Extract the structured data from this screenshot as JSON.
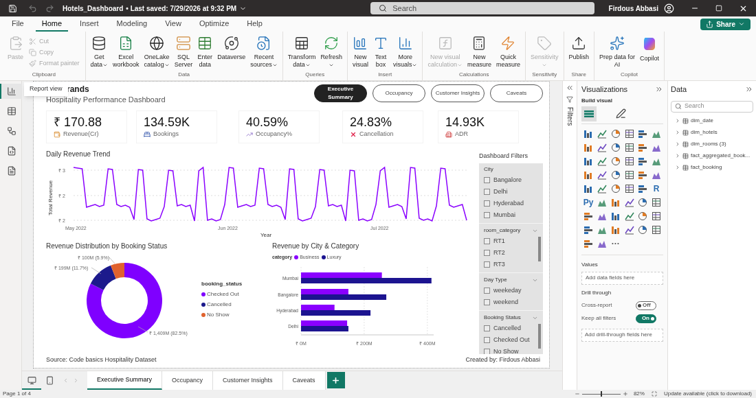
{
  "title_bar": {
    "file_name": "Hotels_Dashboard",
    "saved": "• Last saved: 7/29/2026 at 9:32 PM",
    "search": {
      "placeholder": "Search"
    },
    "user": "Firdous Abbasi"
  },
  "menu_tabs": [
    {
      "label": "File",
      "selected": false
    },
    {
      "label": "Home",
      "selected": true
    },
    {
      "label": "Insert",
      "selected": false
    },
    {
      "label": "Modeling",
      "selected": false
    },
    {
      "label": "View",
      "selected": false
    },
    {
      "label": "Optimize",
      "selected": false
    },
    {
      "label": "Help",
      "selected": false
    }
  ],
  "share_button": {
    "label": "Share"
  },
  "ribbon": [
    {
      "group": "Clipboard",
      "items": [
        {
          "kind": "large",
          "lines": [
            "Paste"
          ],
          "dropdown": false,
          "disabled": true
        },
        {
          "kind": "small",
          "lines": [
            "Cut"
          ],
          "dropdown": false,
          "disabled": true
        },
        {
          "kind": "small",
          "lines": [
            "Copy"
          ],
          "dropdown": false,
          "disabled": true
        },
        {
          "kind": "small",
          "lines": [
            "Format painter"
          ],
          "dropdown": false,
          "disabled": true
        }
      ]
    },
    {
      "group": "Data",
      "items": [
        {
          "kind": "large",
          "lines": [
            "Get",
            "data"
          ],
          "dropdown": true,
          "disabled": false
        },
        {
          "kind": "large",
          "lines": [
            "Excel",
            "workbook"
          ],
          "dropdown": false,
          "disabled": false
        },
        {
          "kind": "large",
          "lines": [
            "OneLake",
            "catalog"
          ],
          "dropdown": true,
          "disabled": false
        },
        {
          "kind": "large",
          "lines": [
            "SQL",
            "Server"
          ],
          "dropdown": false,
          "disabled": false
        },
        {
          "kind": "large",
          "lines": [
            "Enter",
            "data"
          ],
          "dropdown": false,
          "disabled": false
        },
        {
          "kind": "large",
          "lines": [
            "Dataverse"
          ],
          "dropdown": false,
          "disabled": false
        },
        {
          "kind": "large",
          "lines": [
            "Recent",
            "sources"
          ],
          "dropdown": true,
          "disabled": false
        }
      ]
    },
    {
      "group": "Queries",
      "items": [
        {
          "kind": "large",
          "lines": [
            "Transform",
            "data"
          ],
          "dropdown": true,
          "disabled": false
        },
        {
          "kind": "large",
          "lines": [
            "Refresh"
          ],
          "dropdown": true,
          "disabled": false
        }
      ]
    },
    {
      "group": "Insert",
      "items": [
        {
          "kind": "large",
          "lines": [
            "New",
            "visual"
          ],
          "dropdown": false,
          "disabled": false
        },
        {
          "kind": "large",
          "lines": [
            "Text",
            "box"
          ],
          "dropdown": false,
          "disabled": false
        },
        {
          "kind": "large",
          "lines": [
            "More",
            "visuals"
          ],
          "dropdown": true,
          "disabled": false
        }
      ]
    },
    {
      "group": "Calculations",
      "items": [
        {
          "kind": "large",
          "lines": [
            "New visual",
            "calculation"
          ],
          "dropdown": true,
          "disabled": true
        },
        {
          "kind": "large",
          "lines": [
            "New",
            "measure"
          ],
          "dropdown": false,
          "disabled": false
        },
        {
          "kind": "large",
          "lines": [
            "Quick",
            "measure"
          ],
          "dropdown": false,
          "disabled": false
        }
      ]
    },
    {
      "group": "Sensitivity",
      "items": [
        {
          "kind": "large",
          "lines": [
            "Sensitivity"
          ],
          "dropdown": true,
          "disabled": true
        }
      ]
    },
    {
      "group": "Share",
      "items": [
        {
          "kind": "large",
          "lines": [
            "Publish"
          ],
          "dropdown": false,
          "disabled": false
        }
      ]
    },
    {
      "group": "Copilot",
      "items": [
        {
          "kind": "large",
          "lines": [
            "Prep data for",
            "AI"
          ],
          "dropdown": false,
          "disabled": false
        },
        {
          "kind": "large",
          "lines": [
            "Copilot"
          ],
          "dropdown": false,
          "disabled": false
        }
      ]
    }
  ],
  "views": [
    {
      "selected": true
    },
    {
      "selected": false
    },
    {
      "selected": false
    },
    {
      "selected": false
    },
    {
      "selected": false
    }
  ],
  "tooltip": "Report view",
  "report": {
    "title": "rands",
    "subtitle": "Hospitality Performance Dashboard",
    "nav_buttons": [
      {
        "label": "Executive Summary",
        "selected": true
      },
      {
        "label": "Occupancy",
        "selected": false
      },
      {
        "label": "Customer Insights",
        "selected": false
      },
      {
        "label": "Caveats",
        "selected": false
      }
    ],
    "kpis": [
      {
        "value": "₹ 170.88",
        "label": "Revenue(Cr)"
      },
      {
        "value": "134.59K",
        "label": "Bookings"
      },
      {
        "value": "40.59%",
        "label": "Occupancy%"
      },
      {
        "value": "24.83%",
        "label": "Cancellation"
      },
      {
        "value": "14.93K",
        "label": "ADR"
      }
    ],
    "trend_chart": {
      "title": "Daily Revenue Trend",
      "ylabel": "Total Revenue",
      "xlabel": "Year",
      "ytick_labels": [
        "₹ 3",
        "₹ 2",
        "₹ 2"
      ],
      "xtick_labels": [
        "May 2022",
        "Jun 2022",
        "Jul 2022"
      ]
    },
    "donut": {
      "title": "Revenue Distribution by Booking Status",
      "chart_data": {
        "type": "donut",
        "categories": [
          "Checked Out",
          "Cancelled",
          "No Show"
        ],
        "values": [
          82.5,
          11.7,
          5.9
        ],
        "value_labels": [
          "₹ 1,409M (82.5%)",
          "₹ 199M (11.7%)",
          "₹ 100M (5.9%)"
        ]
      },
      "legend": {
        "title": "booking_status",
        "items": [
          {
            "color": "#7f00ff"
          },
          {
            "color": "#1c1a8c"
          },
          {
            "color": "#e0622e"
          }
        ]
      }
    },
    "bar_chart": {
      "title": "Revenue by City & Category",
      "legend_title": "category",
      "chart_data": {
        "type": "bar",
        "orientation": "horizontal",
        "categories": [
          "Mumbai",
          "Bangalore",
          "Hyderabad",
          "Delhi"
        ],
        "series": [
          {
            "name": "Business",
            "color": "#8a00ff",
            "values": [
              256,
              150,
              106,
              146
            ]
          },
          {
            "name": "Luxury",
            "color": "#1c1490",
            "values": [
              413,
              270,
              220,
              150
            ]
          }
        ],
        "xlim": [
          0,
          420
        ],
        "xticks": [
          {
            "value": 0,
            "label": "₹ 0M"
          },
          {
            "value": 200,
            "label": "₹ 200M"
          },
          {
            "value": 400,
            "label": "₹ 400M"
          }
        ]
      }
    },
    "filters": {
      "title": "Dashboard Filters",
      "slicers": [
        {
          "title": "City",
          "dropdown": false,
          "items": [
            {
              "label": "Bangalore",
              "checked": false
            },
            {
              "label": "Delhi",
              "checked": false
            },
            {
              "label": "Hyderabad",
              "checked": false
            },
            {
              "label": "Mumbai",
              "checked": false
            }
          ]
        },
        {
          "title": "room_category",
          "dropdown": true,
          "items": [
            {
              "label": "RT1",
              "checked": false
            },
            {
              "label": "RT2",
              "checked": false
            },
            {
              "label": "RT3",
              "checked": false
            }
          ]
        },
        {
          "title": "Day Type",
          "dropdown": true,
          "items": [
            {
              "label": "weekeday",
              "checked": false
            },
            {
              "label": "weekend",
              "checked": false
            }
          ]
        },
        {
          "title": "Booking Status",
          "dropdown": true,
          "items": [
            {
              "label": "Cancelled",
              "checked": false
            },
            {
              "label": "Checked Out",
              "checked": false
            },
            {
              "label": "No Show",
              "checked": false
            }
          ]
        }
      ]
    },
    "source": "Source: Code basics Hospitality Dataset",
    "credit": "Created by: Firdous Abbasi"
  },
  "page_tabs": [
    {
      "label": "Executive Summary",
      "selected": true
    },
    {
      "label": "Occupancy",
      "selected": false
    },
    {
      "label": "Customer Insights",
      "selected": false
    },
    {
      "label": "Caveats",
      "selected": false
    }
  ],
  "filters_pane": {
    "label": "Filters"
  },
  "visualizations": {
    "title": "Visualizations",
    "subtitle": "Build visual",
    "tabs": [
      {
        "selected": true
      },
      {
        "selected": false
      }
    ],
    "gallery_texts": [
      "R",
      "Py",
      "···"
    ],
    "values": {
      "title": "Values",
      "well": "Add data fields here"
    },
    "drill_through": {
      "title": "Drill through",
      "toggles": [
        {
          "label": "Cross-report",
          "on": false,
          "state_label": "Off"
        },
        {
          "label": "Keep all filters",
          "on": true,
          "state_label": "On"
        }
      ],
      "well": "Add drill-through fields here"
    }
  },
  "data_pane": {
    "title": "Data",
    "search": {
      "placeholder": "Search"
    },
    "tables": [
      {
        "label": "dim_date",
        "expanded": false
      },
      {
        "label": "dim_hotels",
        "expanded": false
      },
      {
        "label": "dim_rooms (3)",
        "expanded": false
      },
      {
        "label": "fact_aggregated_book...",
        "expanded": false
      },
      {
        "label": "fact_booking",
        "expanded": false
      }
    ]
  },
  "status_bar": {
    "page": "Page 1 of 4",
    "zoom": {
      "level": 0.5,
      "reading": "82%"
    },
    "update": "Update available (click to download)"
  }
}
